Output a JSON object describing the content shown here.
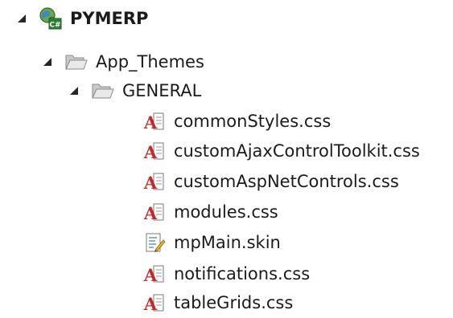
{
  "solution_explorer": {
    "project": {
      "label": "PYMERP",
      "icon": "csharp-web-project-icon",
      "expanded": true
    },
    "folder_app_themes": {
      "label": "App_Themes",
      "icon": "folder-icon",
      "expanded": true
    },
    "folder_general": {
      "label": "GENERAL",
      "icon": "folder-icon",
      "expanded": true
    },
    "files": [
      {
        "label": "commonStyles.css",
        "icon": "css-file-icon"
      },
      {
        "label": "customAjaxControlToolkit.css",
        "icon": "css-file-icon"
      },
      {
        "label": "customAspNetControls.css",
        "icon": "css-file-icon"
      },
      {
        "label": "modules.css",
        "icon": "css-file-icon"
      },
      {
        "label": "mpMain.skin",
        "icon": "skin-file-icon"
      },
      {
        "label": "notifications.css",
        "icon": "css-file-icon"
      },
      {
        "label": "tableGrids.css",
        "icon": "css-file-icon"
      }
    ]
  }
}
